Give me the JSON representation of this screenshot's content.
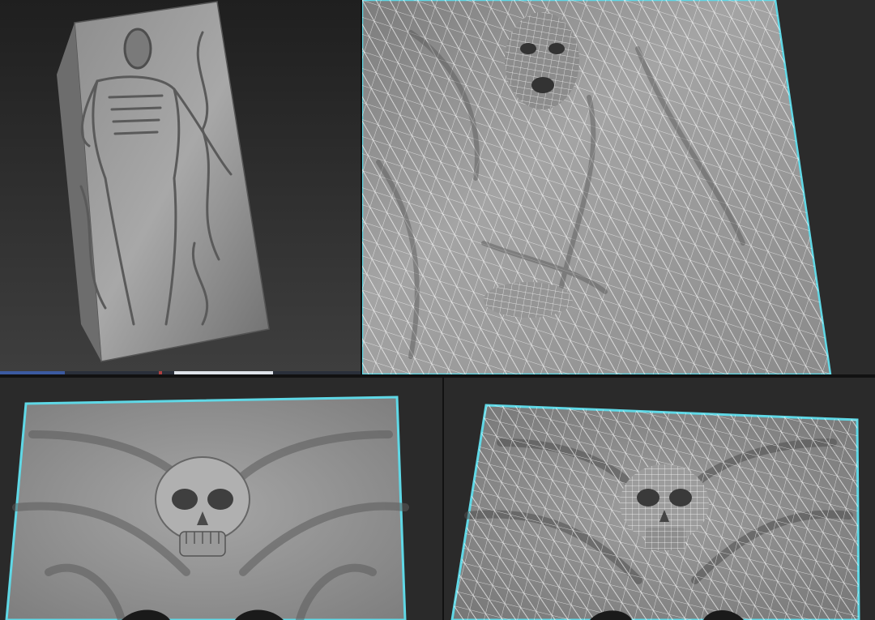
{
  "viewports": [
    {
      "id": "top-left",
      "view": "perspective",
      "shading": "clay-solid",
      "subject": "figure-on-slab",
      "selected": false
    },
    {
      "id": "top-right",
      "view": "perspective",
      "shading": "wireframe-on-shaded",
      "subject": "figure-torso",
      "selected": true
    },
    {
      "id": "bottom-left",
      "view": "perspective",
      "shading": "clay-solid",
      "subject": "skull-relief",
      "selected": true
    },
    {
      "id": "bottom-right",
      "view": "perspective",
      "shading": "wireframe-on-shaded",
      "subject": "skull-relief",
      "selected": true
    }
  ],
  "colors": {
    "background": "#2b2b2b",
    "clay": "#9a9a9a",
    "wire": "#ffffff",
    "selection_outline": "#5fd8e6",
    "divider": "#111111"
  }
}
